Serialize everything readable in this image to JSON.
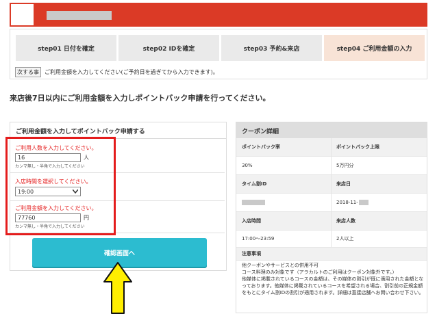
{
  "steps": [
    {
      "label": "step01 日付を確定"
    },
    {
      "label": "step02 IDを確定"
    },
    {
      "label": "step03 予約&来店"
    },
    {
      "label": "step04 ご利用金額の入力"
    }
  ],
  "next": {
    "badge": "次する事",
    "text": "ご利用金額を入力してください(ご予約日を過ぎてから入力できます)。"
  },
  "main_heading": "来店後7日以内にご利用金額を入力しポイントバック申請を行ってください。",
  "form": {
    "title": "ご利用金額を入力してポイントバック申請する",
    "people": {
      "label": "ご利用人数を入力してください。",
      "value": "16",
      "unit": "人",
      "hint": "カンマ無し・半角で入力してください"
    },
    "time": {
      "label": "入店時間を選択してください。",
      "value": "19:00"
    },
    "amount": {
      "label": "ご利用金額を入力してください。",
      "value": "77760",
      "unit": "円",
      "hint": "カンマ無し・半角で入力してください"
    },
    "confirm_label": "確認画面へ"
  },
  "coupon": {
    "title": "クーポン詳細",
    "rows": [
      {
        "left": "ポイントバック率",
        "right": "ポイントバック上限"
      },
      {
        "left": "30%",
        "right": "5万円分"
      },
      {
        "left": "タイム割ID",
        "right": "来店日"
      },
      {
        "left": "",
        "right": "2018-11-"
      },
      {
        "left": "入店時間",
        "right": "来店人数"
      },
      {
        "left": "17:00〜23:59",
        "right": "2人以上"
      }
    ],
    "notes_title": "注意事項",
    "notes": [
      "他クーポンやサービスとの併用不可",
      "コース料理のみ対象です（アラカルトのご利用はクーポン対象外です。）",
      "他媒体に掲載されているコースの金額は、その媒体の割引が既に適用された金額となっております。他媒体に掲載されているコースを希望される場合、割引前の正規金額をもとにタイム割IDの割引が適用されます。詳細は直接店舗へお問い合わせ下さい。"
    ]
  },
  "colors": {
    "header_red": "#db3a26",
    "highlight_red": "#e41c1c",
    "button_teal": "#2cbcd0",
    "arrow_yellow": "#ffee00",
    "active_step": "#f8e3d6"
  }
}
